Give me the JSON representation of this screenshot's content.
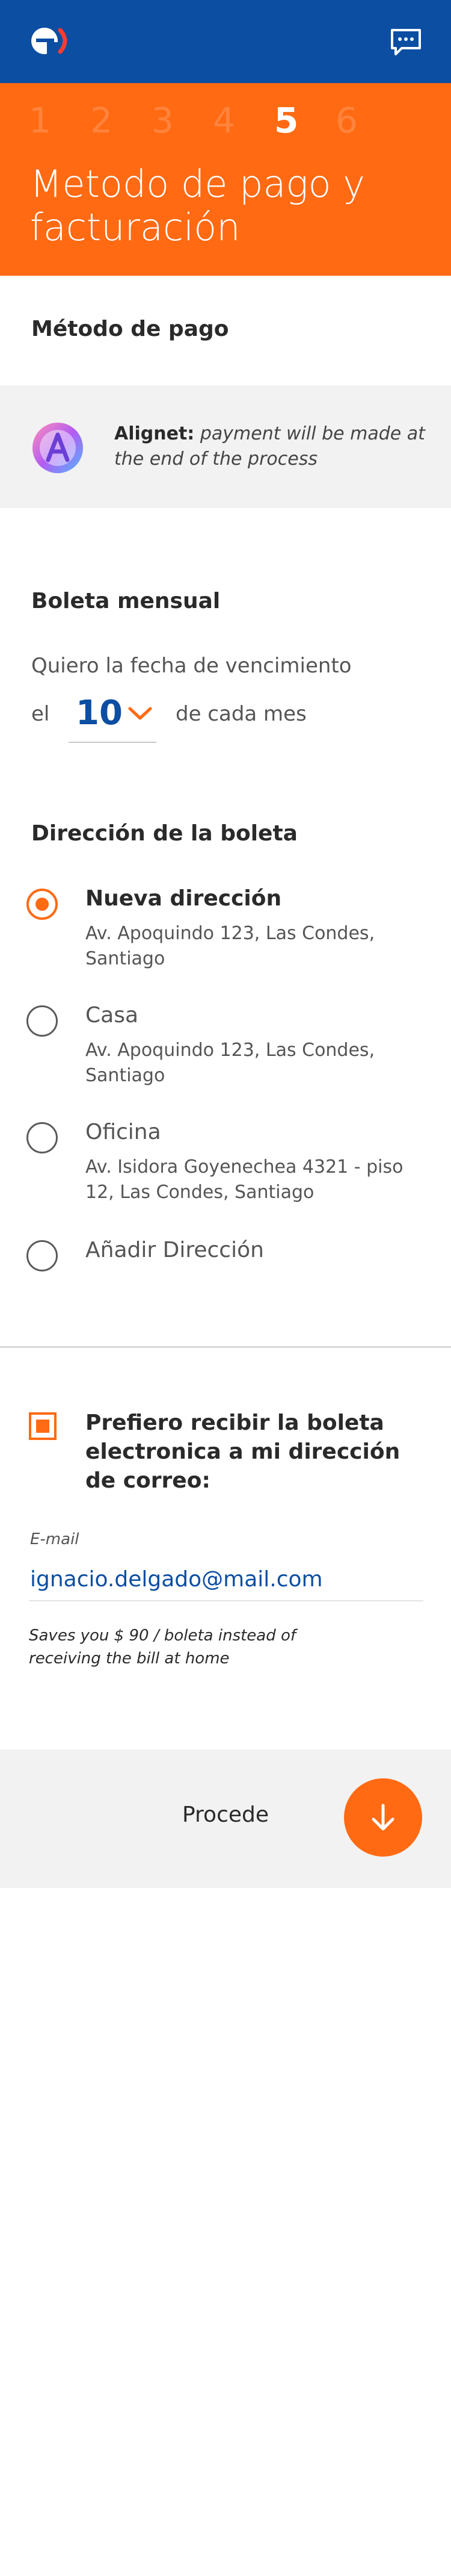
{
  "header": {
    "logo_icon": "entel-logo-icon",
    "chat_icon": "chat-bubble-icon",
    "brand_color": "#0b4ea2"
  },
  "hero": {
    "steps": [
      "1",
      "2",
      "3",
      "4",
      "5",
      "6"
    ],
    "active_step": "5",
    "title": "Metodo de pago y facturación",
    "accent_color": "#ff6a13"
  },
  "payment": {
    "section_title": "Método de pago",
    "provider_icon": "alignet-icon",
    "provider_name": "Alignet:",
    "provider_note": "payment will be made at the end of the process"
  },
  "billing": {
    "section_title": "Boleta mensual",
    "due_prefix": "Quiero la fecha de vencimiento",
    "day_prefix": "el",
    "day_value": "10",
    "day_suffix": "de cada mes"
  },
  "address": {
    "section_title": "Dirección de la boleta",
    "options": [
      {
        "label": "Nueva dirección",
        "detail": "Av. Apoquindo 123, Las Condes, Santiago",
        "selected": true
      },
      {
        "label": "Casa",
        "detail": "Av. Apoquindo 123, Las Condes, Santiago",
        "selected": false
      },
      {
        "label": "Oficina",
        "detail": "Av. Isidora Goyenechea 4321 - piso 12, Las Condes, Santiago",
        "selected": false
      },
      {
        "label": "Añadir Dirección",
        "detail": "",
        "selected": false
      }
    ]
  },
  "ebill": {
    "checkbox_label": "Prefiero recibir la boleta electronica a mi dirección de correo:",
    "checked": true,
    "email_label": "E-mail",
    "email_value": "ignacio.delgado@mail.com",
    "savings_note": "Saves you $ 90 / boleta instead of receiving the bill at home"
  },
  "footer": {
    "proceed_label": "Procede",
    "proceed_icon": "arrow-down-icon"
  }
}
